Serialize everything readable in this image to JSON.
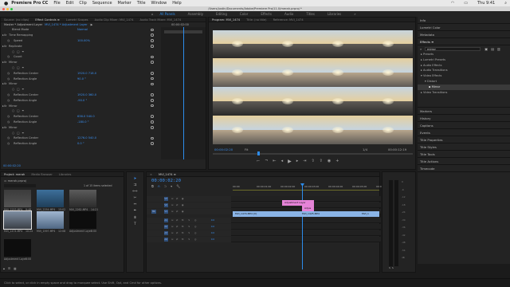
{
  "menubar": {
    "app": "Premiere Pro CC",
    "items": [
      "File",
      "Edit",
      "Clip",
      "Sequence",
      "Marker",
      "Title",
      "Window",
      "Help"
    ],
    "clock": "Thu 9:41"
  },
  "window_title": "/Users/justin/Documents/Adobe/Premiere Pro/11.0/merah.prproj *",
  "workspaces": {
    "active": "All Panels",
    "items": [
      "All Panels",
      "Assembly",
      "Editing",
      "Color",
      "Effects",
      "Audio",
      "Titles",
      "Libraries"
    ]
  },
  "effect_controls": {
    "tabs": [
      "Source: (no clips)",
      "Effect Controls",
      "Lumetri Scopes",
      "Audio Clip Mixer: MVI_1474",
      "Audio Track Mixer: MVI_1474"
    ],
    "active_tab": "Effect Controls",
    "header_menu_icon": "hamburger-menu-icon",
    "header": "Master * Adjustment Layer",
    "header_clip": "MVI_1474 * Adjustment Layer",
    "timecode_top": "00:00:02:00",
    "rows": [
      {
        "label": "Blend Mode",
        "value": "Normal",
        "indent": 12
      },
      {
        "label": "Time Remapping",
        "value": "",
        "indent": 8
      },
      {
        "label": "Speed",
        "value": "100.00%",
        "indent": 14
      },
      {
        "label": "Replicate",
        "value": "",
        "indent": 8
      },
      {
        "label": "",
        "value": "",
        "indent": 0
      },
      {
        "label": "Count",
        "value": "",
        "indent": 14
      },
      {
        "label": "Mirror",
        "value": "",
        "indent": 8
      },
      {
        "label": "",
        "value": "",
        "indent": 0
      },
      {
        "label": "Reflection Center",
        "value": "1920.0   718.0",
        "indent": 14
      },
      {
        "label": "Reflection Angle",
        "value": "90.0 °",
        "indent": 14
      },
      {
        "label": "Mirror",
        "value": "",
        "indent": 8
      },
      {
        "label": "",
        "value": "",
        "indent": 0
      },
      {
        "label": "Reflection Center",
        "value": "1920.0   360.0",
        "indent": 14
      },
      {
        "label": "Reflection Angle",
        "value": "-90.0 °",
        "indent": 14
      },
      {
        "label": "Mirror",
        "value": "",
        "indent": 8
      },
      {
        "label": "",
        "value": "",
        "indent": 0
      },
      {
        "label": "Reflection Center",
        "value": "636.0   540.0",
        "indent": 14
      },
      {
        "label": "Reflection Angle",
        "value": "-180.0 °",
        "indent": 14
      },
      {
        "label": "Mirror",
        "value": "",
        "indent": 8
      },
      {
        "label": "",
        "value": "",
        "indent": 0
      },
      {
        "label": "Reflection Center",
        "value": "1276.0   540.0",
        "indent": 14
      },
      {
        "label": "Reflection Angle",
        "value": "0.0 °",
        "indent": 14
      }
    ],
    "timecode_bottom": "00:00:02:20"
  },
  "program": {
    "tabs": [
      "Program: MVI_1474",
      "Title: (no title)",
      "Reference: MVI_1474"
    ],
    "active_tab": "Program: MVI_1474",
    "timecode": "00:00:02:20",
    "fit": "Fit",
    "fraction": "1/4",
    "duration": "00:00:12:19"
  },
  "right_panel": {
    "sections": [
      "Info",
      "Lumetri Color",
      "Metadata",
      "Effects"
    ],
    "search_value": "mirror",
    "tree": [
      {
        "label": "Presets",
        "level": 0
      },
      {
        "label": "Lumetri Presets",
        "level": 0
      },
      {
        "label": "Audio Effects",
        "level": 0
      },
      {
        "label": "Audio Transitions",
        "level": 0
      },
      {
        "label": "Video Effects",
        "level": 0
      },
      {
        "label": "Distort",
        "level": 1
      },
      {
        "label": "Mirror",
        "level": 2
      },
      {
        "label": "Video Transitions",
        "level": 0
      }
    ],
    "lower_sections": [
      "Markers",
      "History",
      "Captions",
      "Events",
      "Title Properties",
      "Title Styles",
      "Title Tools",
      "Title Actions",
      "Timecode"
    ]
  },
  "project": {
    "tabs": [
      "Project: merah",
      "Media Browser",
      "Libraries"
    ],
    "filename": "merah.prproj",
    "selection": "1 of 15 items selected",
    "clips": [
      {
        "name": "MVI_2253.MP4",
        "duration": "9:48"
      },
      {
        "name": "MVI_2254.MP4",
        "duration": "15:02"
      },
      {
        "name": "MVI_2262.MP4",
        "duration": "14:21"
      },
      {
        "name": "MVI_1474.MP4",
        "duration": "10:24"
      },
      {
        "name": "MVI_1597.MP4",
        "duration": "12:08"
      },
      {
        "name": "Adjustment Layer",
        "duration": "5:00"
      },
      {
        "name": "Adjustment Layer",
        "duration": "5:00"
      }
    ]
  },
  "timeline": {
    "tab": "MVI_1474",
    "timecode": "00:00:02:20",
    "ruler": [
      "00:00",
      "00:00:01:00",
      "00:00:02:00",
      "00:00:03:00",
      "00:00:04:00",
      "00:00:05:00",
      "00:00:06:00"
    ],
    "video_tracks": [
      "V3",
      "V2",
      "V1"
    ],
    "audio_tracks": [
      "A1",
      "A2",
      "A3",
      "A4"
    ],
    "clips": [
      {
        "track": "V2",
        "name": "Adjustment Layer",
        "color": "#e583d7"
      },
      {
        "track": "V2b",
        "name": "Adjus",
        "color": "#e583d7"
      },
      {
        "track": "V1",
        "name": "MVI_1474.MP4 [V]",
        "color": "#8ab4e6"
      },
      {
        "track": "V1",
        "name": "MVI_1425.MP4",
        "color": "#8ab4e6"
      },
      {
        "track": "V1",
        "name": "MVI_1",
        "color": "#8ab4e6"
      }
    ],
    "audio_level": "0.0"
  },
  "status": "Click to select, or click in empty space and drag to marquee select. Use Shift, Opt, and Cmd for other options.",
  "colors": {
    "accent": "#2d8ceb",
    "adjustment_clip": "#e583d7",
    "video_clip": "#8ab4e6",
    "playhead": "#2d8ceb"
  }
}
